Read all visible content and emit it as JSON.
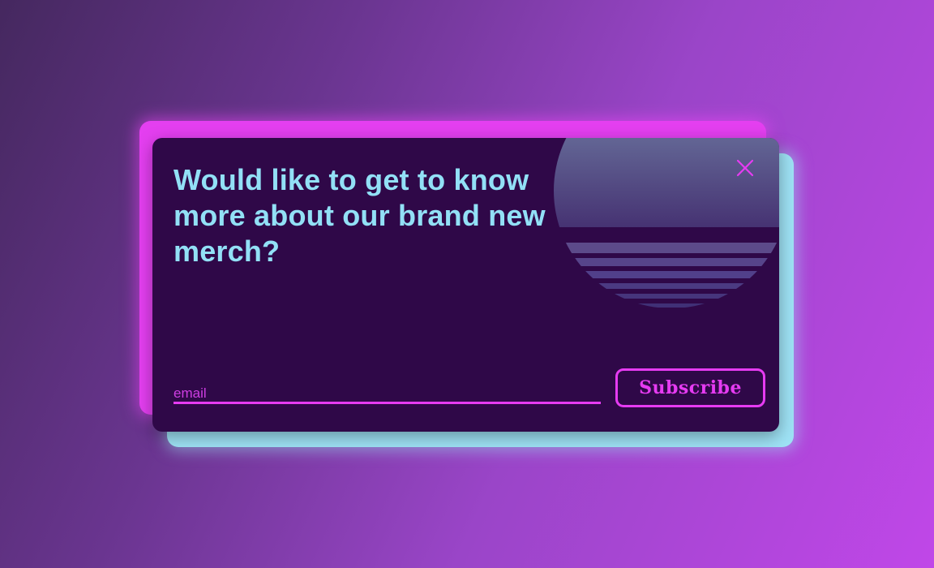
{
  "modal": {
    "heading": "Would like to get to know more about our brand new merch?",
    "email_placeholder": "email",
    "email_value": "",
    "subscribe_label": "Subscribe",
    "close_icon": "close-x-icon"
  },
  "colors": {
    "background_start": "#45285f",
    "background_end": "#c047e8",
    "modal_bg": "#2f0848",
    "heading": "#92e0f6",
    "accent_pink": "#e63bf2",
    "accent_cyan": "#9ee2f5",
    "sun": "#5e6799"
  }
}
